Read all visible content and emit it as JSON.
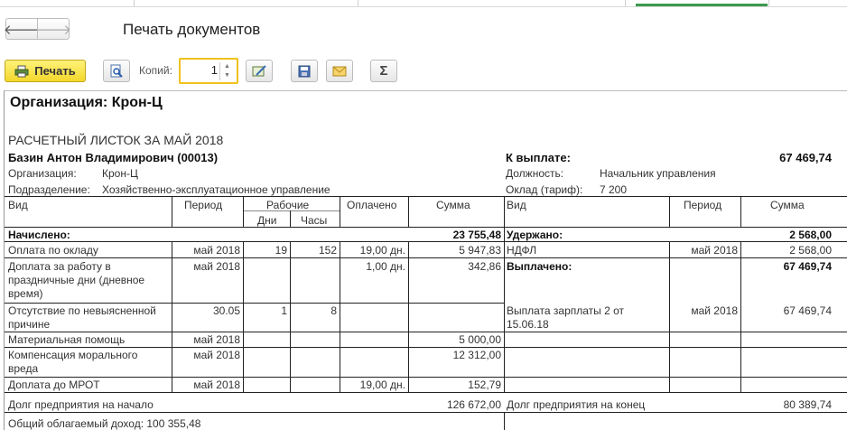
{
  "window": {
    "title": "Печать документов"
  },
  "toolbar": {
    "print_label": "Печать",
    "copies_label": "Копий:",
    "copies_value": "1",
    "sum_label": "Σ"
  },
  "doc": {
    "org_header": "Организация: Крон-Ц",
    "title": "РАСЧЕТНЫЙ ЛИСТОК ЗА МАЙ 2018",
    "employee": "Базин Антон Владимирович (00013)",
    "org_label": "Организация:",
    "org_value": "Крон-Ц",
    "dept_label": "Подразделение:",
    "dept_value": "Хозяйственно-эксплуатационное управление",
    "pay_label": "К выплате:",
    "pay_value": "67 469,74",
    "position_label": "Должность:",
    "position_value": "Начальник управления",
    "salary_label": "Оклад (тариф):",
    "salary_value": "7 200",
    "headers": {
      "vid": "Вид",
      "period": "Период",
      "work": "Рабочие",
      "days": "Дни",
      "hours": "Часы",
      "paid": "Оплачено",
      "sum": "Сумма",
      "vid_r": "Вид",
      "period_r": "Период",
      "sum_r": "Сумма"
    },
    "accrued_label": "Начислено:",
    "accrued_total": "23 755,48",
    "withheld_label": "Удержано:",
    "withheld_total": "2 568,00",
    "left_rows": [
      {
        "vid": "Оплата по окладу",
        "period": "май 2018",
        "days": "19",
        "hours": "152",
        "paid": "19,00 дн.",
        "sum": "5 947,83"
      },
      {
        "vid": "Доплата за работу в праздничные дни (дневное время)",
        "vid_1": "Доплата за работу в",
        "vid_2": "праздничные дни (дневное",
        "vid_3": "время)",
        "period": "май 2018",
        "days": "",
        "hours": "",
        "paid": "1,00 дн.",
        "sum": "342,86"
      },
      {
        "vid_1": "Отсутствие по невыясненной",
        "vid_2": "причине",
        "period": "30.05",
        "days": "1",
        "hours": "8",
        "paid": "",
        "sum": ""
      },
      {
        "vid": "Материальная помощь",
        "period": "май 2018",
        "days": "",
        "hours": "",
        "paid": "",
        "sum": "5 000,00"
      },
      {
        "vid_1": "Компенсация морального",
        "vid_2": "вреда",
        "period": "май 2018",
        "days": "",
        "hours": "",
        "paid": "",
        "sum": "12 312,00"
      },
      {
        "vid": "Доплата до МРОТ",
        "period": "май 2018",
        "days": "",
        "hours": "",
        "paid": "19,00 дн.",
        "sum": "152,79"
      }
    ],
    "right_rows": {
      "ndfl": {
        "vid": "НДФЛ",
        "period": "май 2018",
        "sum": "2 568,00"
      },
      "paid_label": "Выплачено:",
      "paid_total": "67 469,74",
      "salary_payout": {
        "vid_1": "Выплата зарплаты 2 от",
        "vid_2": "15.06.18",
        "period": "май 2018",
        "sum": "67 469,74"
      }
    },
    "debt_start_label": "Долг предприятия на начало",
    "debt_start_value": "126 672,00",
    "debt_end_label": "Долг предприятия на конец",
    "debt_end_value": "80 389,74",
    "taxable_income": "Общий облагаемый доход: 100 355,48"
  },
  "colors": {
    "print_button": "#f3d72b",
    "copies_border": "#f0c21b",
    "accent_tab": "#3c9a4f"
  },
  "icons": [
    "arrow-left-icon",
    "arrow-right-icon",
    "printer-icon",
    "preview-magnifier-icon",
    "edit-icon",
    "save-disk-icon",
    "envelope-icon",
    "sigma-icon"
  ]
}
